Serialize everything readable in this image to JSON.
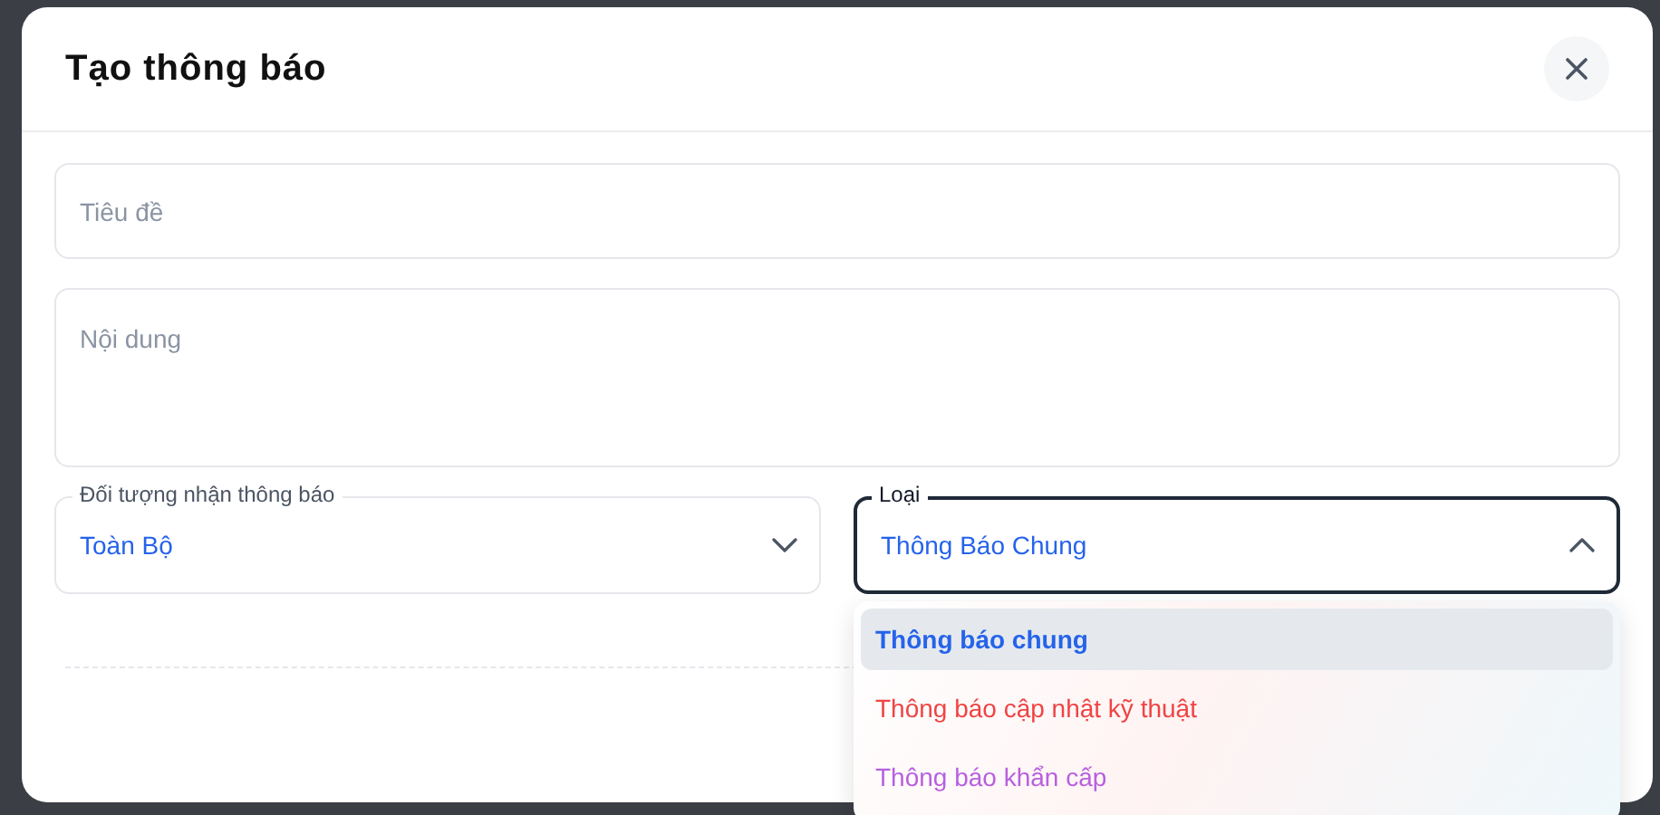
{
  "dialog": {
    "title": "Tạo thông báo"
  },
  "title_field": {
    "placeholder": "Tiêu đề"
  },
  "content_field": {
    "placeholder": "Nội dung"
  },
  "recipient_select": {
    "label": "Đối tượng nhận thông báo",
    "value": "Toàn Bộ",
    "expanded": false
  },
  "type_select": {
    "label": "Loại",
    "value": "Thông Báo Chung",
    "expanded": true,
    "options": [
      {
        "label": "Thông báo chung",
        "selected": true,
        "color": "#2563eb"
      },
      {
        "label": "Thông báo cập nhật kỹ thuật",
        "selected": false,
        "color": "#ef4444"
      },
      {
        "label": "Thông báo khẩn cấp",
        "selected": false,
        "color": "#b760e0"
      }
    ]
  }
}
